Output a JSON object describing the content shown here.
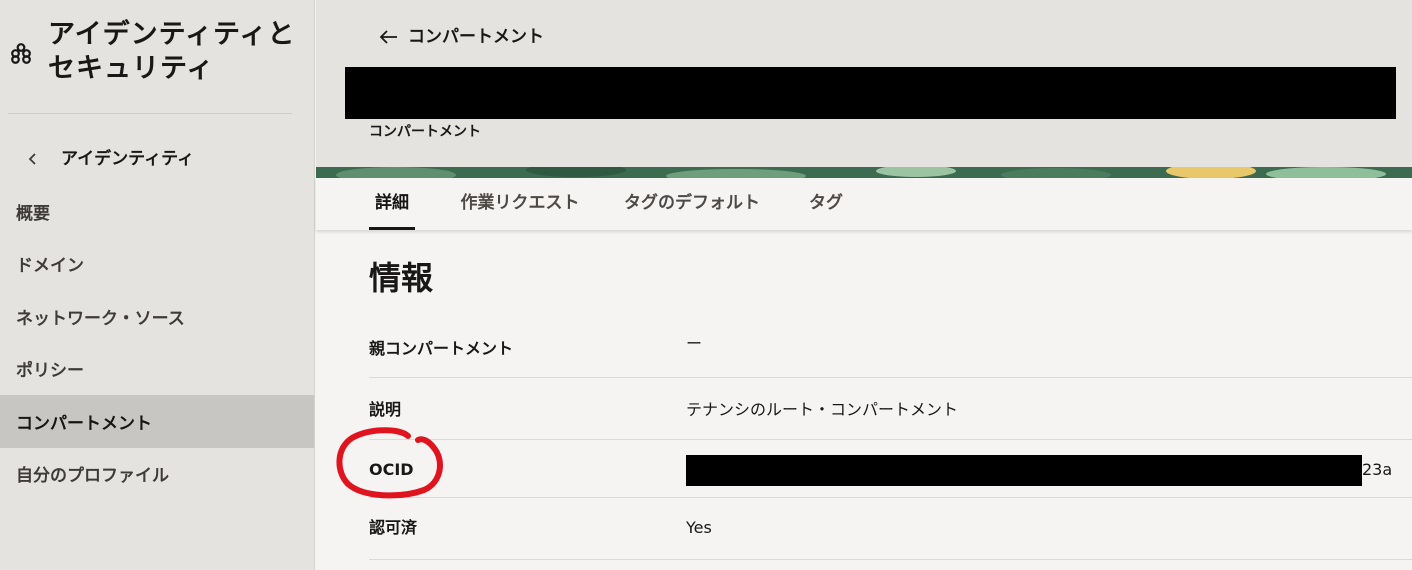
{
  "sidebar": {
    "app_title": "アイデンティティとセキュリティ",
    "logo_icon": "oci-logo-icon",
    "back_label": "アイデンティティ",
    "items": [
      {
        "label": "概要",
        "active": false
      },
      {
        "label": "ドメイン",
        "active": false
      },
      {
        "label": "ネットワーク・ソース",
        "active": false
      },
      {
        "label": "ポリシー",
        "active": false
      },
      {
        "label": "コンパートメント",
        "active": true
      },
      {
        "label": "自分のプロファイル",
        "active": false
      }
    ]
  },
  "header": {
    "breadcrumb_label": "コンパートメント",
    "resource_type": "コンパートメント"
  },
  "tabs": [
    {
      "label": "詳細",
      "active": true
    },
    {
      "label": "作業リクエスト",
      "active": false
    },
    {
      "label": "タグのデフォルト",
      "active": false
    },
    {
      "label": "タグ",
      "active": false
    }
  ],
  "info": {
    "title": "情報",
    "rows": [
      {
        "label": "親コンパートメント",
        "value": "ー"
      },
      {
        "label": "説明",
        "value": "テナンシのルート・コンパートメント"
      },
      {
        "label": "OCID",
        "value": "23a"
      },
      {
        "label": "認可済",
        "value": "Yes"
      }
    ]
  },
  "colors": {
    "annotation": "#e0141e",
    "active_nav_bg": "#c8c6c2",
    "sidebar_bg": "#e4e3e0",
    "banner_green": "#3c6b4f"
  }
}
